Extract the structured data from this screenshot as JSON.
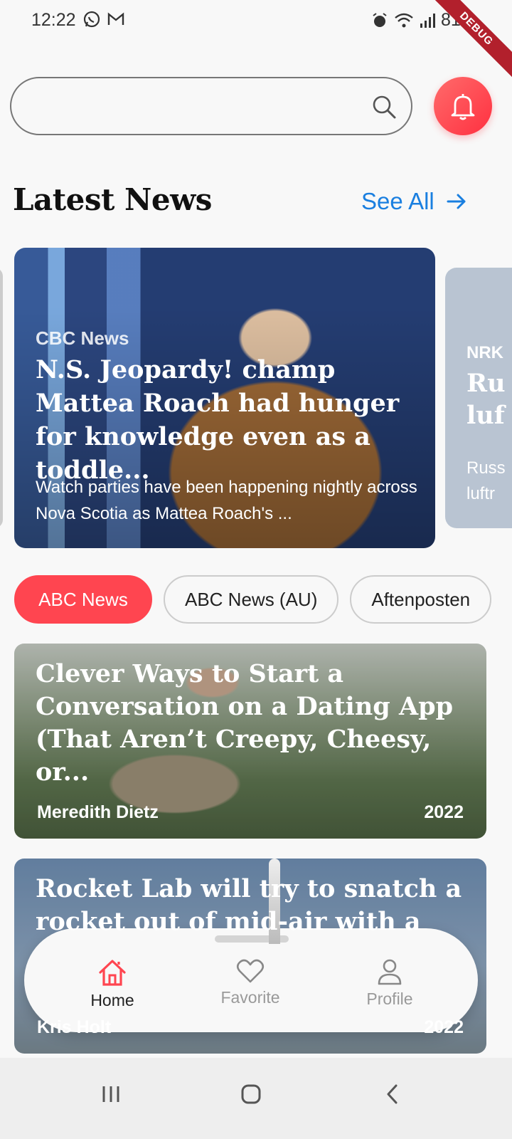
{
  "status_bar": {
    "time": "12:22",
    "battery": "81%",
    "debug_label": "DEBUG"
  },
  "search": {
    "placeholder": "",
    "value": ""
  },
  "latest": {
    "title": "Latest News",
    "see_all": "See All",
    "cards": [
      {
        "source": "CBC News",
        "headline": "N.S. Jeopardy! champ Mattea Roach had hunger for knowledge even as a toddle...",
        "description": "Watch parties have been happening nightly across Nova Scotia as Mattea Roach's ..."
      },
      {
        "source": "NRK",
        "headline_line1": "Ru",
        "headline_line2": "luf",
        "desc_line1": "Russ",
        "desc_line2": "luftr"
      }
    ]
  },
  "categories": [
    {
      "label": "ABC News",
      "active": true
    },
    {
      "label": "ABC News (AU)",
      "active": false
    },
    {
      "label": "Aftenposten",
      "active": false
    }
  ],
  "articles": [
    {
      "headline": "Clever Ways to Start a Conversation on a Dating App (That Aren’t Creepy, Cheesy, or...",
      "author": "Meredith Dietz",
      "year": "2022"
    },
    {
      "headline": "Rocket Lab will try to snatch a rocket out of mid-air with a",
      "author": "Kris Holt",
      "year": "2022"
    }
  ],
  "bottom_nav": {
    "items": [
      {
        "label": "Home",
        "icon": "home-icon",
        "active": true
      },
      {
        "label": "Favorite",
        "icon": "heart-icon",
        "active": false
      },
      {
        "label": "Profile",
        "icon": "person-icon",
        "active": false
      }
    ]
  },
  "colors": {
    "accent": "#ff4550",
    "link": "#1a7fe0"
  }
}
